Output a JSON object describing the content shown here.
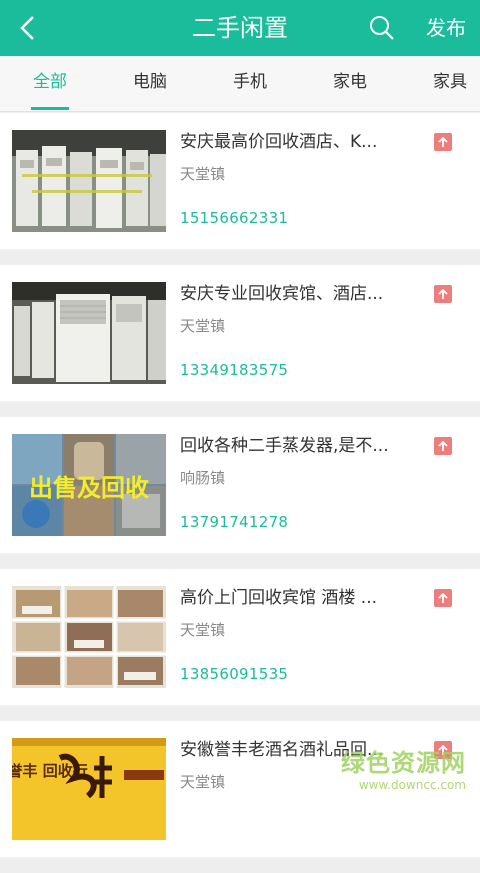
{
  "header": {
    "title": "二手闲置",
    "publish_label": "发布",
    "accent_color": "#1bbc9b"
  },
  "tabs": [
    {
      "label": "全部",
      "active": true
    },
    {
      "label": "电脑",
      "active": false
    },
    {
      "label": "手机",
      "active": false
    },
    {
      "label": "家电",
      "active": false
    },
    {
      "label": "家具",
      "active": false
    }
  ],
  "listings": [
    {
      "title": "安庆最高价回收酒店、K...",
      "location": "天堂镇",
      "phone": "15156662331",
      "thumb": "air-conditioners-photo"
    },
    {
      "title": "安庆专业回收宾馆、酒店...",
      "location": "天堂镇",
      "phone": "13349183575",
      "thumb": "air-conditioners-photo"
    },
    {
      "title": "回收各种二手蒸发器,是不...",
      "location": "响肠镇",
      "phone": "13791741278",
      "thumb": "evaporator-collage-photo",
      "thumb_caption": "出售及回收"
    },
    {
      "title": "高价上门回收宾馆 酒楼 ...",
      "location": "天堂镇",
      "phone": "13856091535",
      "thumb": "hotel-rooms-collage-photo"
    },
    {
      "title": "安徽誉丰老酒名酒礼品回...",
      "location": "天堂镇",
      "phone": "",
      "thumb": "liquor-shop-sign-photo",
      "thumb_caption": "安徽 誉丰 回收行"
    }
  ],
  "watermark": {
    "text": "绿色资源网",
    "url": "www.downcc.com"
  }
}
